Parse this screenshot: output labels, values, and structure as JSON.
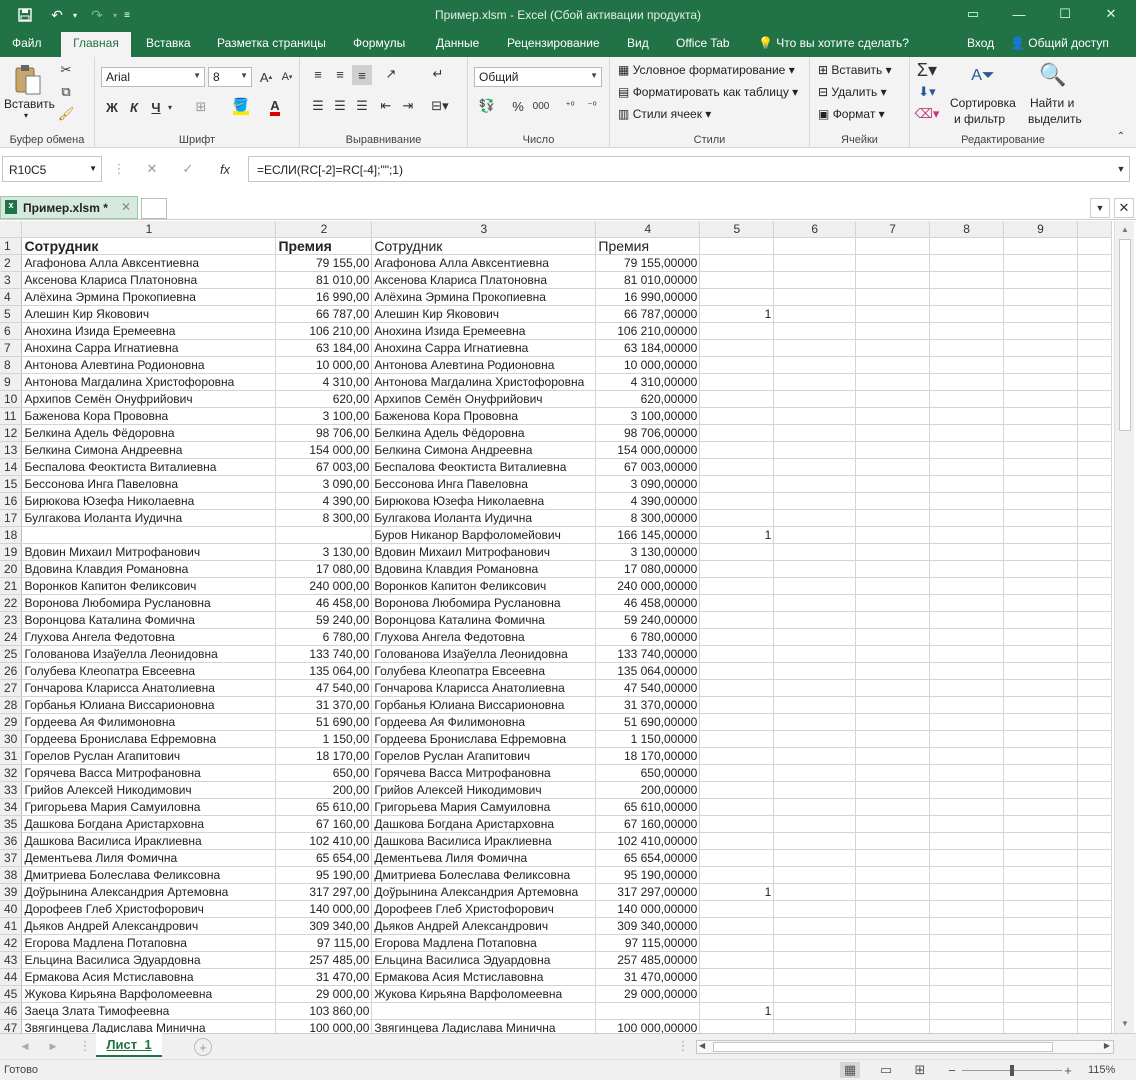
{
  "window": {
    "title": "Пример.xlsm - Excel (Сбой активации продукта)"
  },
  "ribbon_tabs": [
    "Файл",
    "Главная",
    "Вставка",
    "Разметка страницы",
    "Формулы",
    "Данные",
    "Рецензирование",
    "Вид",
    "Office Tab"
  ],
  "tellme": "Что вы хотите сделать?",
  "signin": "Вход",
  "share": "Общий доступ",
  "groups": {
    "clipboard": "Буфер обмена",
    "font": "Шрифт",
    "align": "Выравнивание",
    "number": "Число",
    "styles": "Стили",
    "cells": "Ячейки",
    "edit": "Редактирование"
  },
  "clipboard": {
    "paste": "Вставить"
  },
  "font": {
    "name": "Arial",
    "size": "8",
    "bold": "Ж",
    "italic": "К",
    "underline": "Ч"
  },
  "number": {
    "format": "Общий",
    "percent": "%",
    "thousands": "000"
  },
  "styles": {
    "cond": "Условное форматирование",
    "table": "Форматировать как таблицу",
    "cell": "Стили ячеек"
  },
  "cells": {
    "insert": "Вставить",
    "delete": "Удалить",
    "format": "Формат"
  },
  "edit": {
    "sort1": "Сортировка",
    "sort2": "и фильтр",
    "find1": "Найти и",
    "find2": "выделить"
  },
  "namebox": "R10C5",
  "formula": "=ЕСЛИ(RC[-2]=RC[-4];\"\";1)",
  "file_tab": "Пример.xlsm *",
  "columns": [
    "1",
    "2",
    "3",
    "4",
    "5",
    "6",
    "7",
    "8",
    "9"
  ],
  "rows": [
    {
      "n": "1",
      "a": "Сотрудник",
      "b": "Премия",
      "c": "Сотрудник",
      "d": "Премия",
      "e": ""
    },
    {
      "n": "2",
      "a": "Агафонова Алла Авксентиевна",
      "b": "79 155,00",
      "c": "Агафонова Алла Авксентиевна",
      "d": "79 155,00000",
      "e": ""
    },
    {
      "n": "3",
      "a": "Аксенова Клариса Платоновна",
      "b": "81 010,00",
      "c": "Аксенова Клариса Платоновна",
      "d": "81 010,00000",
      "e": ""
    },
    {
      "n": "4",
      "a": "Алёхина Эрмина Прокопиевна",
      "b": "16 990,00",
      "c": "Алёхина Эрмина Прокопиевна",
      "d": "16 990,00000",
      "e": ""
    },
    {
      "n": "5",
      "a": "Алешин Кир Яковович",
      "b": "66 787,00",
      "c": "Алешин Кир Яковович",
      "d": "66 787,00000",
      "e": "1"
    },
    {
      "n": "6",
      "a": "Анохина Изида Еремеевна",
      "b": "106 210,00",
      "c": "Анохина Изида Еремеевна",
      "d": "106 210,00000",
      "e": ""
    },
    {
      "n": "7",
      "a": "Анохина Сарра Игнатиевна",
      "b": "63 184,00",
      "c": "Анохина Сарра Игнатиевна",
      "d": "63 184,00000",
      "e": ""
    },
    {
      "n": "8",
      "a": "Антонова Алевтина Родионовна",
      "b": "10 000,00",
      "c": "Антонова Алевтина Родионовна",
      "d": "10 000,00000",
      "e": ""
    },
    {
      "n": "9",
      "a": "Антонова Магдалина Христофоровна",
      "b": "4 310,00",
      "c": "Антонова Магдалина Христофоровна",
      "d": "4 310,00000",
      "e": ""
    },
    {
      "n": "10",
      "a": "Архипов Семён Онуфрийович",
      "b": "620,00",
      "c": "Архипов Семён Онуфрийович",
      "d": "620,00000",
      "e": ""
    },
    {
      "n": "11",
      "a": "Баженова Кора Прововна",
      "b": "3 100,00",
      "c": "Баженова Кора Прововна",
      "d": "3 100,00000",
      "e": ""
    },
    {
      "n": "12",
      "a": "Белкина Адель Фёдоровна",
      "b": "98 706,00",
      "c": "Белкина Адель Фёдоровна",
      "d": "98 706,00000",
      "e": ""
    },
    {
      "n": "13",
      "a": "Белкина Симона Андреевна",
      "b": "154 000,00",
      "c": "Белкина Симона Андреевна",
      "d": "154 000,00000",
      "e": ""
    },
    {
      "n": "14",
      "a": "Беспалова Феоктиста Виталиевна",
      "b": "67 003,00",
      "c": "Беспалова Феоктиста Виталиевна",
      "d": "67 003,00000",
      "e": ""
    },
    {
      "n": "15",
      "a": "Бессонова Инга Павеловна",
      "b": "3 090,00",
      "c": "Бессонова Инга Павеловна",
      "d": "3 090,00000",
      "e": ""
    },
    {
      "n": "16",
      "a": "Бирюкова Юзефа Николаевна",
      "b": "4 390,00",
      "c": "Бирюкова Юзефа Николаевна",
      "d": "4 390,00000",
      "e": ""
    },
    {
      "n": "17",
      "a": "Булгакова Иоланта Иудична",
      "b": "8 300,00",
      "c": "Булгакова Иоланта Иудична",
      "d": "8 300,00000",
      "e": ""
    },
    {
      "n": "18",
      "a": "",
      "b": "",
      "c": "Буров Никанор Варфоломейович",
      "d": "166 145,00000",
      "e": "1"
    },
    {
      "n": "19",
      "a": "Вдовин Михаил Митрофанович",
      "b": "3 130,00",
      "c": "Вдовин Михаил Митрофанович",
      "d": "3 130,00000",
      "e": ""
    },
    {
      "n": "20",
      "a": "Вдовина Клавдия Романовна",
      "b": "17 080,00",
      "c": "Вдовина Клавдия Романовна",
      "d": "17 080,00000",
      "e": ""
    },
    {
      "n": "21",
      "a": "Воронков Капитон Феликсович",
      "b": "240 000,00",
      "c": "Воронков Капитон Феликсович",
      "d": "240 000,00000",
      "e": ""
    },
    {
      "n": "22",
      "a": "Воронова Любомира Руслановна",
      "b": "46 458,00",
      "c": "Воронова Любомира Руслановна",
      "d": "46 458,00000",
      "e": ""
    },
    {
      "n": "23",
      "a": "Воронцова Каталина Фомична",
      "b": "59 240,00",
      "c": "Воронцова Каталина Фомична",
      "d": "59 240,00000",
      "e": ""
    },
    {
      "n": "24",
      "a": "Глухова Ангела Федотовна",
      "b": "6 780,00",
      "c": "Глухова Ангела Федотовна",
      "d": "6 780,00000",
      "e": ""
    },
    {
      "n": "25",
      "a": "Голованова Изаўелла Леонидовна",
      "b": "133 740,00",
      "c": "Голованова Изаўелла Леонидовна",
      "d": "133 740,00000",
      "e": ""
    },
    {
      "n": "26",
      "a": "Голубева Клеопатра Евсеевна",
      "b": "135 064,00",
      "c": "Голубева Клеопатра Евсеевна",
      "d": "135 064,00000",
      "e": ""
    },
    {
      "n": "27",
      "a": "Гончарова Кларисса Анатолиевна",
      "b": "47 540,00",
      "c": "Гончарова Кларисса Анатолиевна",
      "d": "47 540,00000",
      "e": ""
    },
    {
      "n": "28",
      "a": "Горбанья Юлиана Виссарионовна",
      "b": "31 370,00",
      "c": "Горбанья Юлиана Виссарионовна",
      "d": "31 370,00000",
      "e": ""
    },
    {
      "n": "29",
      "a": "Гордеева Ая Филимоновна",
      "b": "51 690,00",
      "c": "Гордеева Ая Филимоновна",
      "d": "51 690,00000",
      "e": ""
    },
    {
      "n": "30",
      "a": "Гордеева Бронислава Ефремовна",
      "b": "1 150,00",
      "c": "Гордеева Бронислава Ефремовна",
      "d": "1 150,00000",
      "e": ""
    },
    {
      "n": "31",
      "a": "Горелов Руслан Агапитович",
      "b": "18 170,00",
      "c": "Горелов Руслан Агапитович",
      "d": "18 170,00000",
      "e": ""
    },
    {
      "n": "32",
      "a": "Горячева Васса Митрофановна",
      "b": "650,00",
      "c": "Горячева Васса Митрофановна",
      "d": "650,00000",
      "e": ""
    },
    {
      "n": "33",
      "a": "Грийов Алексей Никодимович",
      "b": "200,00",
      "c": "Грийов Алексей Никодимович",
      "d": "200,00000",
      "e": ""
    },
    {
      "n": "34",
      "a": "Григорьева Мария Самуиловна",
      "b": "65 610,00",
      "c": "Григорьева Мария Самуиловна",
      "d": "65 610,00000",
      "e": ""
    },
    {
      "n": "35",
      "a": "Дашкова Богдана Аристарховна",
      "b": "67 160,00",
      "c": "Дашкова Богдана Аристарховна",
      "d": "67 160,00000",
      "e": ""
    },
    {
      "n": "36",
      "a": "Дашкова Василиса Ираклиевна",
      "b": "102 410,00",
      "c": "Дашкова Василиса Ираклиевна",
      "d": "102 410,00000",
      "e": ""
    },
    {
      "n": "37",
      "a": "Дементьева Лиля Фомична",
      "b": "65 654,00",
      "c": "Дементьева Лиля Фомична",
      "d": "65 654,00000",
      "e": ""
    },
    {
      "n": "38",
      "a": "Дмитриева Болеслава Феликсовна",
      "b": "95 190,00",
      "c": "Дмитриева Болеслава Феликсовна",
      "d": "95 190,00000",
      "e": ""
    },
    {
      "n": "39",
      "a": "Доўрынина Александрия Артемовна",
      "b": "317 297,00",
      "c": "Доўрынина Александрия Артемовна",
      "d": "317 297,00000",
      "e": "1"
    },
    {
      "n": "40",
      "a": "Дорофеев Глеб Христофорович",
      "b": "140 000,00",
      "c": "Дорофеев Глеб Христофорович",
      "d": "140 000,00000",
      "e": ""
    },
    {
      "n": "41",
      "a": "Дьяков Андрей Александрович",
      "b": "309 340,00",
      "c": "Дьяков Андрей Александрович",
      "d": "309 340,00000",
      "e": ""
    },
    {
      "n": "42",
      "a": "Егорова Мадлена Потаповна",
      "b": "97 115,00",
      "c": "Егорова Мадлена Потаповна",
      "d": "97 115,00000",
      "e": ""
    },
    {
      "n": "43",
      "a": "Ельцина Василиса Эдуардовна",
      "b": "257 485,00",
      "c": "Ельцина Василиса Эдуардовна",
      "d": "257 485,00000",
      "e": ""
    },
    {
      "n": "44",
      "a": "Ермакова Асия Мстиславовна",
      "b": "31 470,00",
      "c": "Ермакова Асия Мстиславовна",
      "d": "31 470,00000",
      "e": ""
    },
    {
      "n": "45",
      "a": "Жукова Кирьяна Варфоломеевна",
      "b": "29 000,00",
      "c": "Жукова Кирьяна Варфоломеевна",
      "d": "29 000,00000",
      "e": ""
    },
    {
      "n": "46",
      "a": "Заеца Злата Тимофеевна",
      "b": "103 860,00",
      "c": "",
      "d": "",
      "e": "1"
    },
    {
      "n": "47",
      "a": "Звягинцева Ладислава Миничнa",
      "b": "100 000,00",
      "c": "Звягинцева Ладислава Миничнa",
      "d": "100 000,00000",
      "e": ""
    }
  ],
  "sheet_tab": "Лист_1",
  "status": {
    "ready": "Готово",
    "zoom": "115%"
  }
}
